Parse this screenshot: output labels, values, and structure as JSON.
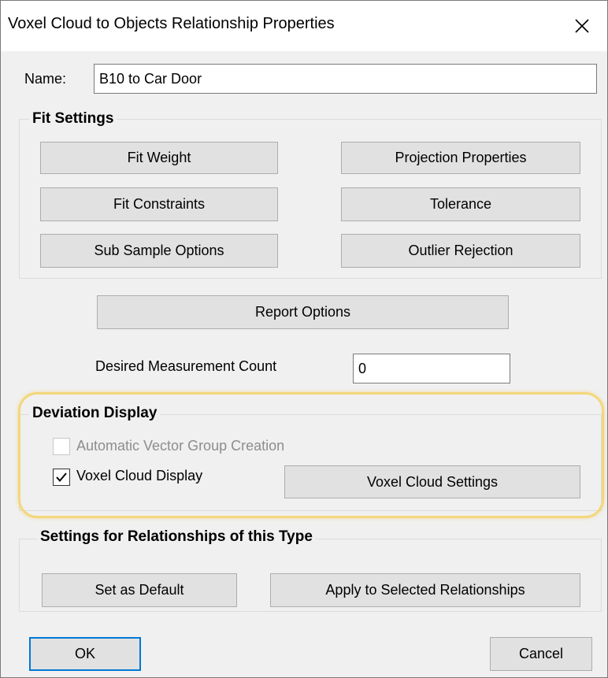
{
  "window": {
    "title": "Voxel Cloud to Objects Relationship Properties",
    "close_icon": "close-icon"
  },
  "name_field": {
    "label": "Name:",
    "value": "B10 to Car Door"
  },
  "fit_settings": {
    "title": "Fit Settings",
    "buttons": {
      "fit_weight": "Fit Weight",
      "projection_properties": "Projection Properties",
      "fit_constraints": "Fit Constraints",
      "tolerance": "Tolerance",
      "sub_sample_options": "Sub Sample Options",
      "outlier_rejection": "Outlier Rejection"
    }
  },
  "report_options_label": "Report Options",
  "measurement": {
    "label": "Desired Measurement Count",
    "value": "0"
  },
  "deviation_display": {
    "title": "Deviation Display",
    "auto_vector_label": "Automatic Vector Group Creation",
    "auto_vector_checked": false,
    "auto_vector_enabled": false,
    "voxel_display_label": "Voxel Cloud Display",
    "voxel_display_checked": true,
    "voxel_settings_label": "Voxel Cloud Settings",
    "highlight_color": "#f3d77a"
  },
  "relationship_settings": {
    "title": "Settings for Relationships of this Type",
    "set_default_label": "Set as Default",
    "apply_selected_label": "Apply to Selected Relationships"
  },
  "footer": {
    "ok_label": "OK",
    "cancel_label": "Cancel"
  },
  "colors": {
    "dialog_bg": "#f0f0f0",
    "button_bg": "#e1e1e1",
    "default_button_border": "#0078d7"
  }
}
